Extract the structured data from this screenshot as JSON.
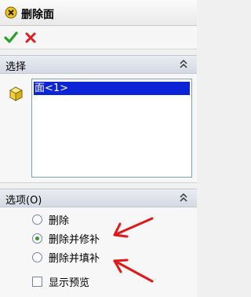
{
  "title": "删除面",
  "actions": {
    "ok": "ok-checkmark",
    "cancel": "cancel-x"
  },
  "selection_section": {
    "label": "选择",
    "items": [
      "面<1>"
    ]
  },
  "options_section": {
    "label": "选项(O)",
    "options": [
      {
        "label": "删除",
        "selected": false
      },
      {
        "label": "删除并修补",
        "selected": true
      },
      {
        "label": "删除并填补",
        "selected": false
      }
    ],
    "preview_label": "显示预览",
    "preview_checked": false
  },
  "colors": {
    "selection_highlight": "#0a24d6",
    "annotation_arrow": "#e01818",
    "ok_green": "#28a028",
    "cancel_red": "#d81e1e"
  }
}
